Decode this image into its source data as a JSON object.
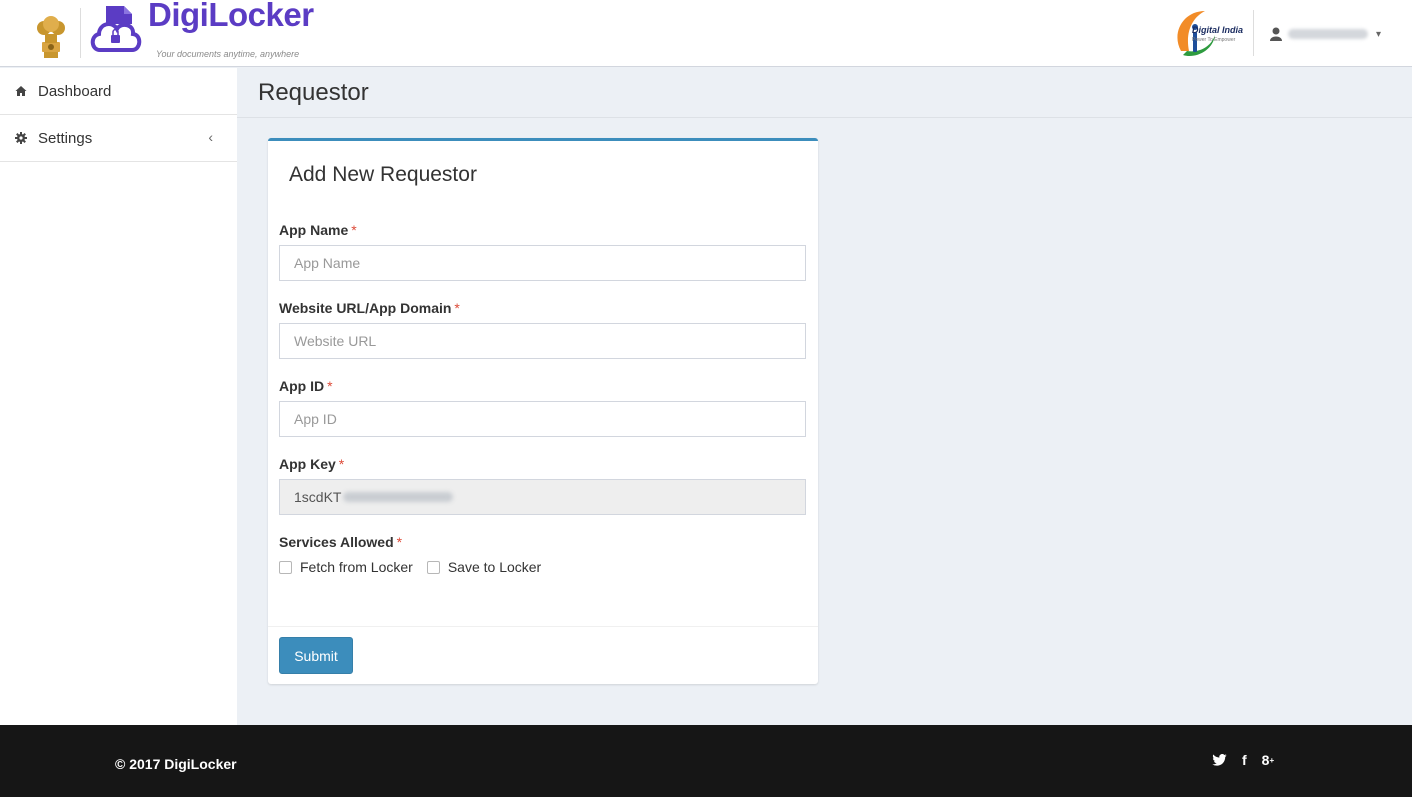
{
  "header": {
    "brand_name": "DigiLocker",
    "brand_tagline": "Your documents anytime, anywhere",
    "digital_india_title": "Digital India",
    "digital_india_subtitle": "Power To Empower",
    "user_name": "avantpuvn"
  },
  "sidebar": {
    "items": [
      {
        "label": "Dashboard",
        "icon": "home-icon"
      },
      {
        "label": "Settings",
        "icon": "gear-icon",
        "chevron": "‹"
      }
    ]
  },
  "page": {
    "title": "Requestor"
  },
  "form": {
    "title": "Add New Requestor",
    "required_mark": "*",
    "fields": [
      {
        "label": "App Name",
        "placeholder": "App Name"
      },
      {
        "label": "Website URL/App Domain",
        "placeholder": "Website URL"
      },
      {
        "label": "App ID",
        "placeholder": "App ID"
      },
      {
        "label": "App Key",
        "value": "1scdKT"
      }
    ],
    "services_label": "Services Allowed",
    "services": [
      {
        "label": "Fetch from Locker"
      },
      {
        "label": "Save to Locker"
      }
    ],
    "submit_label": "Submit"
  },
  "footer": {
    "copyright": "© 2017 DigiLocker",
    "social": [
      "twitter-icon",
      "facebook-icon",
      "google-plus-icon"
    ]
  },
  "colors": {
    "brand": "#5b3cc4",
    "primary": "#3c8dbc",
    "required": "#dd4b39",
    "footer_bg": "#161616"
  }
}
